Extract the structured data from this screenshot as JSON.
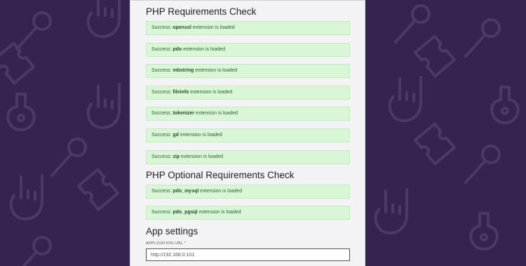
{
  "colors": {
    "background": "#35244f",
    "panel": "#f3f3f6",
    "success_bg": "#d9f7d6",
    "success_text": "#2f5f2f"
  },
  "requirements": {
    "title": "PHP Requirements Check",
    "items": [
      {
        "prefix": "Success:",
        "name": "openssl",
        "suffix": "extension is loaded"
      },
      {
        "prefix": "Success:",
        "name": "pdo",
        "suffix": "extension is loaded"
      },
      {
        "prefix": "Success:",
        "name": "mbstring",
        "suffix": "extension is loaded"
      },
      {
        "prefix": "Success:",
        "name": "fileinfo",
        "suffix": "extension is loaded"
      },
      {
        "prefix": "Success:",
        "name": "tokenizer",
        "suffix": "extension is loaded"
      },
      {
        "prefix": "Success:",
        "name": "gd",
        "suffix": "extension is loaded"
      },
      {
        "prefix": "Success:",
        "name": "zip",
        "suffix": "extension is loaded"
      }
    ]
  },
  "optional": {
    "title": "PHP Optional Requirements Check",
    "items": [
      {
        "prefix": "Success:",
        "name": "pdo_mysql",
        "suffix": "extension is loaded"
      },
      {
        "prefix": "Success:",
        "name": "pdo_pgsql",
        "suffix": "extension is loaded"
      }
    ]
  },
  "app_settings": {
    "title": "App settings",
    "url_label": "APPLICATION URL",
    "required_mark": "*",
    "url_value": "http://192.168.0.101"
  },
  "background_icons": [
    "microphone-icon",
    "ticket-icon",
    "rock-hand-icon",
    "guitar-icon"
  ]
}
